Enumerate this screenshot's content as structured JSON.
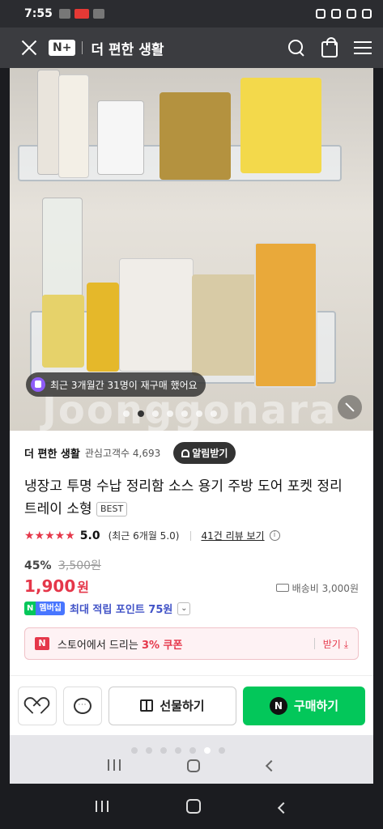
{
  "status_bar": {
    "time": "7:55"
  },
  "header": {
    "brand": "N+",
    "store_title": "더 편한 생활"
  },
  "photo": {
    "repurchase_text": "최근 3개월간 31명이 재구매 했어요",
    "watermark": "Joonggonara",
    "slide_count": 7,
    "active_slide": 1
  },
  "store": {
    "name": "더 편한 생활",
    "fans": "관심고객수 4,693",
    "alarm_label": "알림받기"
  },
  "product": {
    "title": "냉장고 투명 수납 정리함 소스 용기 주방 도어 포켓 정리 트레이 소형",
    "badge": "BEST",
    "stars": "★★★★★",
    "rating": "5.0",
    "rating_recent": "(최근 6개월 5.0)",
    "review_link": "41건 리뷰 보기",
    "discount": "45%",
    "original_price": "3,500원",
    "price": "1,900",
    "price_unit": "원",
    "shipping": "배송비 3,000원",
    "membership_n": "N",
    "membership_label": "멤버십",
    "points": "최대 적립 포인트 75원"
  },
  "coupon": {
    "logo": "N",
    "text_prefix": "스토어에서 드리는 ",
    "text_highlight": "3% 쿠폰",
    "get_label": "받기"
  },
  "actions": {
    "gift_label": "선물하기",
    "buy_label": "구매하기",
    "buy_logo": "N",
    "chat_glyph": "···"
  },
  "inner_nav": {
    "slide_count": 7,
    "active_slide": 5
  },
  "colors": {
    "accent_red": "#e5374a",
    "naver_green": "#03c75a",
    "points_blue": "#4153c7"
  }
}
